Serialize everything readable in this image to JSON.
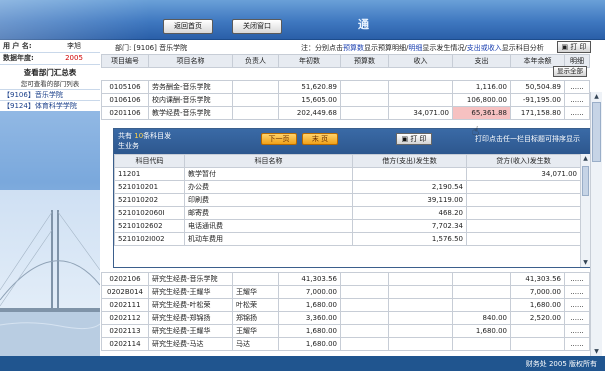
{
  "topbar": {
    "back_label": "返回首页",
    "close_label": "关闭窗口",
    "brand": "通"
  },
  "left": {
    "username_key": "用 户 名:",
    "username": "李旭",
    "year_key": "数据年度:",
    "year": "2005",
    "summary_title": "查看部门汇总表",
    "summary_sub": "您可查看的部门列表",
    "depts": [
      "【9106】音乐学院",
      "【9124】体育科学学院"
    ]
  },
  "main": {
    "dept_label": "部门:",
    "dept_value": "[9106] 音乐学院",
    "note": {
      "p1": "注：分别点击",
      "l1": "预算数",
      "p2": "显示预算明细/",
      "l2": "明细",
      "p3": "显示发生情况/",
      "l3": "支出或收入",
      "p4": "显示科目分析"
    },
    "print_label": "打 印",
    "show_all_label": "显示全部",
    "headers": [
      "项目编号",
      "项目名称",
      "负责人",
      "年初数",
      "预算数",
      "收入",
      "支出",
      "本年余额",
      "明细"
    ],
    "rows": [
      {
        "code": "0105106",
        "name": "劳务酬金-音乐学院",
        "owner": "",
        "init": "51,620.89",
        "budget": "",
        "income": "",
        "expense": "1,116.00",
        "balance": "50,504.89",
        "more": "......"
      },
      {
        "code": "0106106",
        "name": "校内课酬-音乐学院",
        "owner": "",
        "init": "15,605.00",
        "budget": "",
        "income": "",
        "expense": "106,800.00",
        "balance": "-91,195.00",
        "more": "......"
      },
      {
        "code": "0201106",
        "name": "教学经费-音乐学院",
        "owner": "",
        "init": "202,449.68",
        "budget": "",
        "income": "34,071.00",
        "expense": "65,361.88",
        "balance": "171,158.80",
        "more": "......"
      }
    ],
    "lower_rows": [
      {
        "code": "0202106",
        "name": "研究生经费-音乐学院",
        "owner": "",
        "init": "41,303.56",
        "budget": "",
        "income": "",
        "expense": "",
        "balance": "41,303.56",
        "more": "......"
      },
      {
        "code": "0202B014",
        "name": "研究生经费-王耀华",
        "owner": "王耀华",
        "init": "7,000.00",
        "budget": "",
        "income": "",
        "expense": "",
        "balance": "7,000.00",
        "more": "......"
      },
      {
        "code": "0202111",
        "name": "研究生经费-叶松荣",
        "owner": "叶松荣",
        "init": "1,680.00",
        "budget": "",
        "income": "",
        "expense": "",
        "balance": "1,680.00",
        "more": "......"
      },
      {
        "code": "0202112",
        "name": "研究生经费-郑锦扬",
        "owner": "郑锦扬",
        "init": "3,360.00",
        "budget": "",
        "income": "",
        "expense": "840.00",
        "balance": "2,520.00",
        "more": "......"
      },
      {
        "code": "0202113",
        "name": "研究生经费-王耀华",
        "owner": "王耀华",
        "init": "1,680.00",
        "budget": "",
        "income": "",
        "expense": "1,680.00",
        "balance": "",
        "more": "......"
      },
      {
        "code": "0202114",
        "name": "研究生经费-马达",
        "owner": "马达",
        "init": "1,680.00",
        "budget": "",
        "income": "",
        "expense": "",
        "balance": "",
        "more": "......"
      }
    ]
  },
  "detail": {
    "count_prefix": "共有",
    "count": "10",
    "count_suffix": "条科目发",
    "count_line2": "生业务",
    "prev_label": "下一页",
    "last_label": "末 页",
    "print_label": "打 印",
    "hint": "打印点击任一栏目标题可排序显示",
    "headers": [
      "科目代码",
      "科目名称",
      "借方(支出)发生数",
      "贷方(收入)发生数"
    ],
    "rows": [
      {
        "code": "11201",
        "name": "教学暂付",
        "debit": "",
        "credit": "34,071.00"
      },
      {
        "code": "521010201",
        "name": "办公费",
        "debit": "2,190.54",
        "credit": ""
      },
      {
        "code": "521010202",
        "name": "印刷费",
        "debit": "39,119.00",
        "credit": ""
      },
      {
        "code": "5210102060I",
        "name": "邮寄费",
        "debit": "468.20",
        "credit": ""
      },
      {
        "code": "5210102602",
        "name": "电话通讯费",
        "debit": "7,702.34",
        "credit": ""
      },
      {
        "code": "5210102I002",
        "name": "机动车费用",
        "debit": "1,576.50",
        "credit": ""
      }
    ]
  },
  "footer": {
    "text": "财务处 2005 版权所有"
  }
}
